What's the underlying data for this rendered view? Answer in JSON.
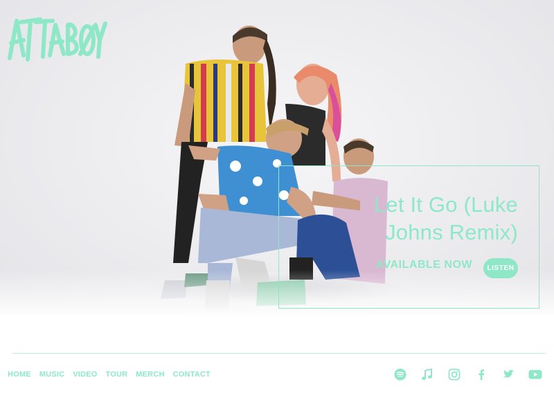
{
  "brand": {
    "logo_text": "ATTABØY",
    "accent": "#8ee8c8"
  },
  "promo": {
    "title": "Let It Go (Luke Johns Remix)",
    "availability": "AVAILABLE NOW",
    "button_label": "LISTEN"
  },
  "nav": {
    "items": [
      {
        "label": "HOME"
      },
      {
        "label": "MUSIC"
      },
      {
        "label": "VIDEO"
      },
      {
        "label": "TOUR"
      },
      {
        "label": "MERCH"
      },
      {
        "label": "CONTACT"
      }
    ]
  },
  "social": {
    "icons": [
      "spotify-icon",
      "apple-music-icon",
      "instagram-icon",
      "facebook-icon",
      "twitter-icon",
      "youtube-icon"
    ]
  }
}
